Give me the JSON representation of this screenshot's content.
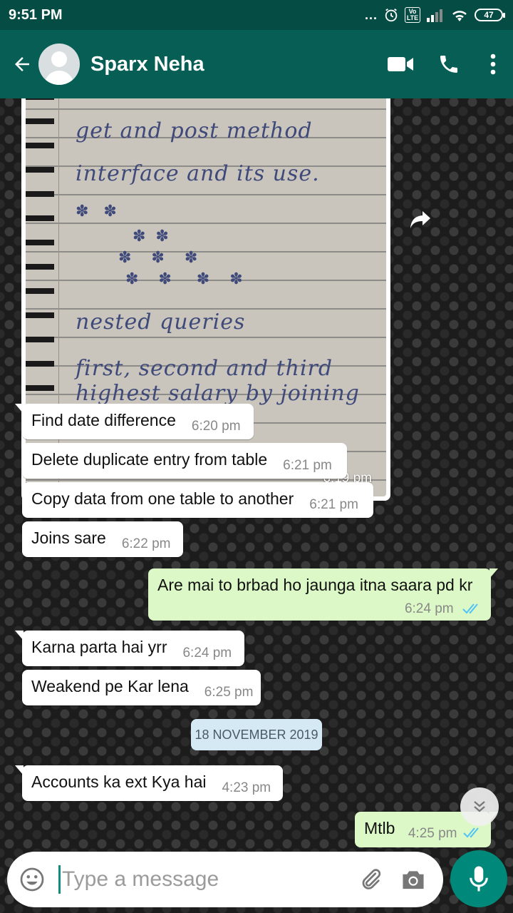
{
  "status_bar": {
    "time": "9:51 PM",
    "dots": "...",
    "volte": "Vo LTE",
    "battery": "47"
  },
  "header": {
    "contact_name": "Sparx Neha",
    "icons": [
      "back-arrow-icon",
      "avatar",
      "video-call-icon",
      "phone-icon",
      "more-vert-icon"
    ]
  },
  "colors": {
    "header": "#075e54",
    "status_bar": "#054c44",
    "outgoing_bubble": "#dcf8c6",
    "incoming_bubble": "#ffffff",
    "date_chip": "#d5e9f4",
    "mic_button": "#00897b",
    "read_ticks": "#4fc3f7"
  },
  "image_message": {
    "time": "6:19 pm",
    "handwritten_lines": [
      "get and post method",
      "interface and its use.",
      "nested queries",
      "first, second and third",
      "highest salary by joining"
    ]
  },
  "messages": [
    {
      "direction": "in",
      "text": "Find date difference",
      "time": "6:20 pm"
    },
    {
      "direction": "in",
      "text": "Delete duplicate entry from table",
      "time": "6:21 pm"
    },
    {
      "direction": "in",
      "text": "Copy data from one table to another",
      "time": "6:21 pm"
    },
    {
      "direction": "in",
      "text": "Joins sare",
      "time": "6:22 pm"
    },
    {
      "direction": "out",
      "text": "Are mai to brbad ho jaunga itna saara pd kr",
      "time": "6:24 pm",
      "status": "read"
    },
    {
      "direction": "in",
      "text": "Karna parta hai yrr",
      "time": "6:24 pm"
    },
    {
      "direction": "in",
      "text": "Weakend pe Kar lena",
      "time": "6:25 pm"
    },
    {
      "direction": "in",
      "text": "Accounts ka ext Kya hai",
      "time": "4:23 pm"
    },
    {
      "direction": "out",
      "text": "Mtlb",
      "time": "4:25 pm",
      "status": "read"
    }
  ],
  "date_separator": "18 NOVEMBER 2019",
  "composer": {
    "placeholder": "Type a message",
    "value": ""
  }
}
